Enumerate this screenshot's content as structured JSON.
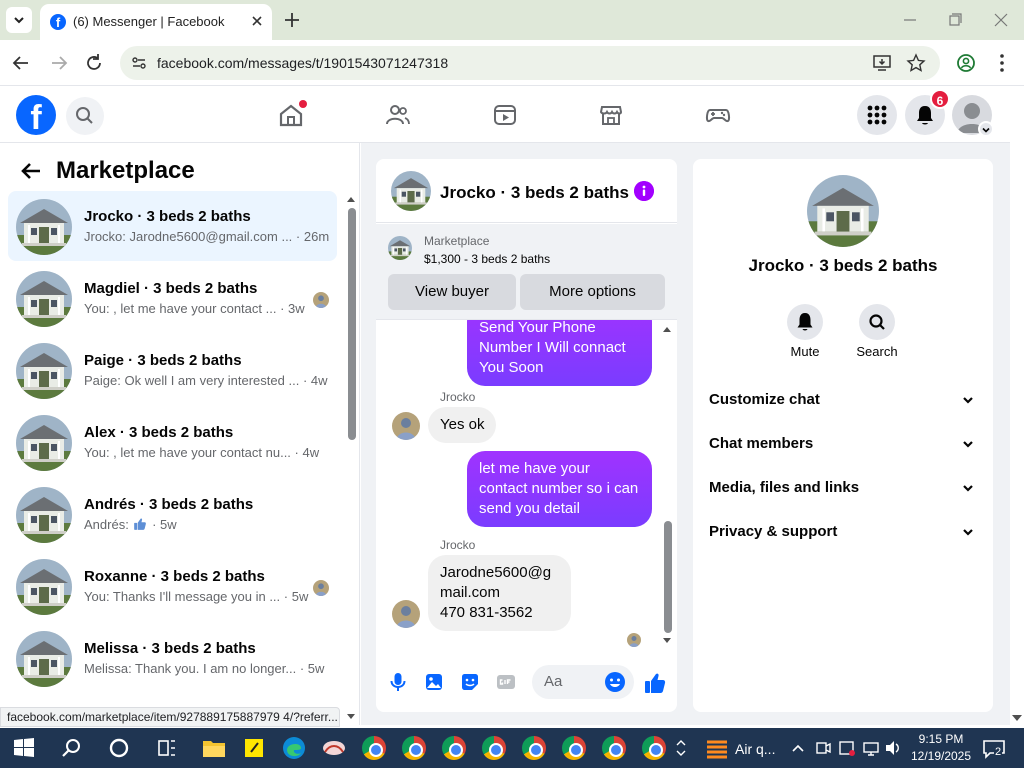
{
  "browser": {
    "tab_title": "(6) Messenger | Facebook",
    "url": "facebook.com/messages/t/1901543071247318",
    "status_url": "facebook.com/marketplace/item/927889175887979 4/?referr..."
  },
  "fb": {
    "notification_count": "6"
  },
  "left_panel": {
    "title": "Marketplace",
    "conversations": [
      {
        "name": "Jrocko · 3 beds 2 baths",
        "preview": "Jrocko: Jarodne5600@gmail.com ...",
        "time": "· 26m"
      },
      {
        "name": "Magdiel · 3 beds 2 baths",
        "preview": "You: , let me have your contact ...",
        "time": "· 3w"
      },
      {
        "name": "Paige · 3 beds 2 baths",
        "preview": "Paige: Ok well I am very interested ...",
        "time": "· 4w"
      },
      {
        "name": "Alex · 3 beds 2 baths",
        "preview": "You: , let me have your contact nu...",
        "time": "· 4w"
      },
      {
        "name": "Andrés · 3 beds 2 baths",
        "preview": "Andrés:",
        "time": "· 5w"
      },
      {
        "name": "Roxanne · 3 beds 2 baths",
        "preview": "You: Thanks I'll message you in ...",
        "time": "· 5w"
      },
      {
        "name": "Melissa · 3 beds 2 baths",
        "preview": "Melissa: Thank you. I am no longer...",
        "time": "· 5w"
      }
    ]
  },
  "chat": {
    "title": "Jrocko · 3 beds 2 baths",
    "marketplace_label": "Marketplace",
    "listing": "$1,300 - 3 beds 2 baths",
    "view_buyer": "View buyer",
    "more_options": "More options",
    "messages": {
      "out1": "Send Your Phone Number I Will connact You Soon",
      "sender1": "Jrocko",
      "in1": "Yes ok",
      "out2": "let me have your contact number so i can send you detail",
      "sender2": "Jrocko",
      "in2_line1": "Jarodne5600@g",
      "in2_line2": "mail.com",
      "in2_line3": "470 831-3562"
    },
    "composer_placeholder": "Aa"
  },
  "right_panel": {
    "title": "Jrocko · 3 beds 2 baths",
    "mute": "Mute",
    "search": "Search",
    "sections": [
      "Customize chat",
      "Chat members",
      "Media, files and links",
      "Privacy & support"
    ]
  },
  "taskbar": {
    "weather": "Air q...",
    "time": "9:15 PM",
    "date": "12/19/2025",
    "notif_count": "2"
  }
}
